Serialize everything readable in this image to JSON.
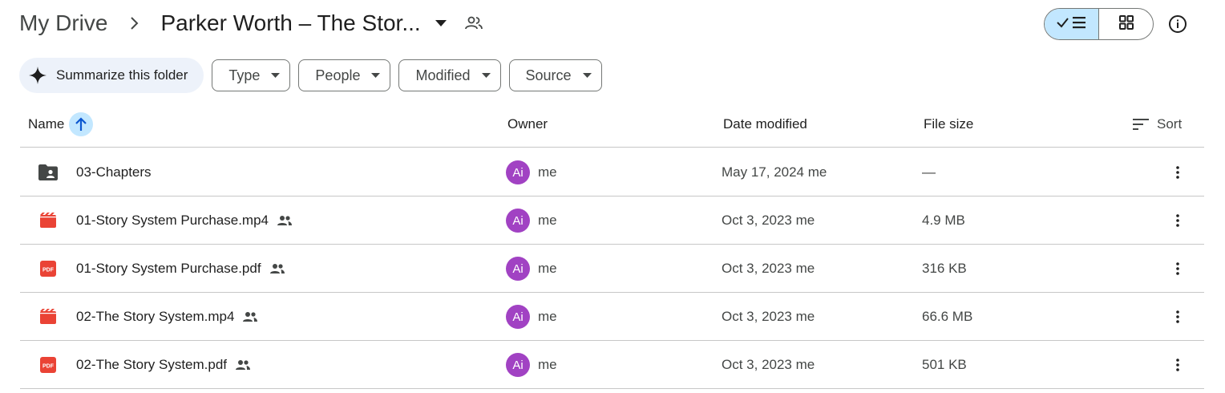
{
  "breadcrumb": {
    "root": "My Drive",
    "current": "Parker Worth – The Stor...",
    "caret_icon": "arrow-drop-down-icon",
    "shared_icon": "people-outline-icon"
  },
  "view": {
    "list_icon": "check-list-icon",
    "grid_icon": "grid-icon",
    "info_icon": "info-icon",
    "active": "list"
  },
  "filters": {
    "summarize": "Summarize this folder",
    "chips": [
      "Type",
      "People",
      "Modified",
      "Source"
    ]
  },
  "columns": {
    "name": "Name",
    "owner": "Owner",
    "date_modified": "Date modified",
    "file_size": "File size",
    "sort": "Sort"
  },
  "rows": [
    {
      "name": "03-Chapters",
      "type": "shared-folder",
      "shared": false,
      "owner_initials": "Ai",
      "owner": "me",
      "date": "May 17, 2024 me",
      "size": "—"
    },
    {
      "name": "01-Story System Purchase.mp4",
      "type": "video",
      "shared": true,
      "owner_initials": "Ai",
      "owner": "me",
      "date": "Oct 3, 2023 me",
      "size": "4.9 MB"
    },
    {
      "name": "01-Story System Purchase.pdf",
      "type": "pdf",
      "shared": true,
      "owner_initials": "Ai",
      "owner": "me",
      "date": "Oct 3, 2023 me",
      "size": "316 KB"
    },
    {
      "name": "02-The Story System.mp4",
      "type": "video",
      "shared": true,
      "owner_initials": "Ai",
      "owner": "me",
      "date": "Oct 3, 2023 me",
      "size": "66.6 MB"
    },
    {
      "name": "02-The Story System.pdf",
      "type": "pdf",
      "shared": true,
      "owner_initials": "Ai",
      "owner": "me",
      "date": "Oct 3, 2023 me",
      "size": "501 KB"
    }
  ],
  "colors": {
    "accent": "#c2e7ff",
    "avatar": "#a142c3",
    "video_red": "#ea4335",
    "pdf_red": "#ea4335",
    "folder_gray": "#444746",
    "border": "#c7c7c7"
  }
}
